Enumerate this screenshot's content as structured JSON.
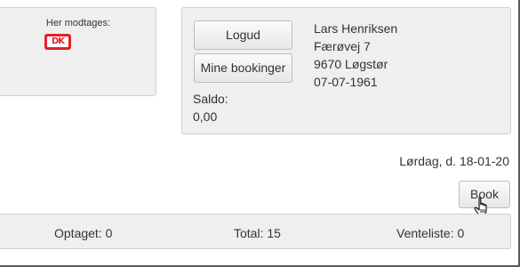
{
  "payment": {
    "label": "Her modtages:",
    "card_logo_text": "DK",
    "card_brand_color": "#e3202a"
  },
  "user": {
    "logout_label": "Logud",
    "my_bookings_label": "Mine bookinger",
    "name": "Lars Henriksen",
    "street": "Færøvej 7",
    "city": "9670 Løgstør",
    "birthdate": "07-07-1961",
    "balance_label": "Saldo:",
    "balance_value": "0,00"
  },
  "booking": {
    "date_text": "Lørdag, d. 18-01-20",
    "book_label": "Book"
  },
  "stats": {
    "taken": "Optaget: 0",
    "total": "Total: 15",
    "waitlist": "Venteliste: 0"
  },
  "colors": {
    "panel_background": "#efefef",
    "panel_border": "#cfcfcf",
    "text": "#333333"
  },
  "icons": {
    "cursor": "hand-pointer-icon"
  }
}
